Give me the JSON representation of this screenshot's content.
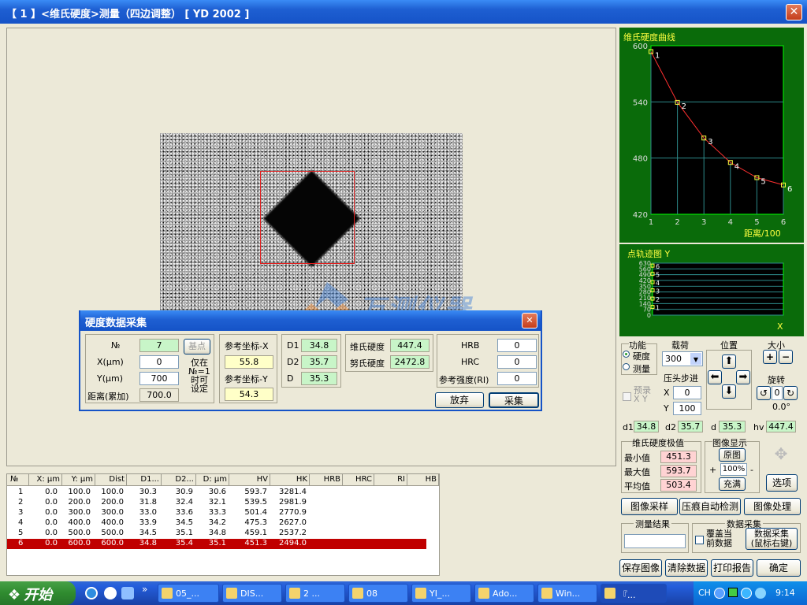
{
  "window": {
    "title": "【 1 】<维氏硬度>测量（四边调整）  [ YD 2002 ]",
    "close": "✕"
  },
  "watermark": "万测仪器",
  "dialog": {
    "title": "硬度数据采集",
    "close": "✕",
    "no_label": "№",
    "no_value": "7",
    "base_btn": "基点",
    "x_label": "X(μm)",
    "x_value": "0",
    "y_label": "Y(μm)",
    "y_value": "700",
    "dist_label": "距离(累加)",
    "dist_value": "700.0",
    "note": "仅在\n№=1\n时可\n设定",
    "refx_label": "参考坐标-X",
    "refx_value": "55.8",
    "refy_label": "参考坐标-Y",
    "refy_value": "54.3",
    "d1_label": "D1",
    "d1_value": "34.8",
    "d2_label": "D2",
    "d2_value": "35.7",
    "d_label": "D",
    "d_value": "35.3",
    "hv_label": "维氏硬度",
    "hv_value": "447.4",
    "hk_label": "努氏硬度",
    "hk_value": "2472.8",
    "hrb_label": "HRB",
    "hrb_value": "0",
    "hrc_label": "HRC",
    "hrc_value": "0",
    "ri_label": "参考强度(RI)",
    "ri_value": "0",
    "discard_btn": "放弃",
    "collect_btn": "采集"
  },
  "table": {
    "headers": [
      "№",
      "X: μm",
      "Y: μm",
      "Dist",
      "D1...",
      "D2...",
      "D: μm",
      "HV",
      "HK",
      "HRB",
      "HRC",
      "RI",
      "HB"
    ],
    "rows": [
      [
        "1",
        "0.0",
        "100.0",
        "100.0",
        "30.3",
        "30.9",
        "30.6",
        "593.7",
        "3281.4"
      ],
      [
        "2",
        "0.0",
        "200.0",
        "200.0",
        "31.8",
        "32.4",
        "32.1",
        "539.5",
        "2981.9"
      ],
      [
        "3",
        "0.0",
        "300.0",
        "300.0",
        "33.0",
        "33.6",
        "33.3",
        "501.4",
        "2770.9"
      ],
      [
        "4",
        "0.0",
        "400.0",
        "400.0",
        "33.9",
        "34.5",
        "34.2",
        "475.3",
        "2627.0"
      ],
      [
        "5",
        "0.0",
        "500.0",
        "500.0",
        "34.5",
        "35.1",
        "34.8",
        "459.1",
        "2537.2"
      ],
      [
        "6",
        "0.0",
        "600.0",
        "600.0",
        "34.8",
        "35.4",
        "35.1",
        "451.3",
        "2494.0"
      ]
    ],
    "selected_row": 5
  },
  "chart_data": [
    {
      "type": "line",
      "title": "维氏硬度曲线",
      "xlabel": "距离/100",
      "ylabel": "",
      "x": [
        1,
        2,
        3,
        4,
        5,
        6
      ],
      "series": [
        {
          "values": [
            593.7,
            539.5,
            501.4,
            475.3,
            459.1,
            451.3
          ]
        }
      ],
      "point_labels": [
        "1",
        "2",
        "3",
        "4",
        "5",
        "6"
      ],
      "ylim": [
        420,
        600
      ],
      "xlim": [
        1,
        6
      ],
      "y_ticks": [
        "600",
        "540",
        "480",
        "420"
      ],
      "x_ticks": [
        "1",
        "2",
        "3",
        "4",
        "5",
        "6"
      ],
      "grid": true,
      "colors": {
        "bg": "#0A6B0A",
        "plot": "#000000",
        "line": "#FF3030",
        "marker": "#FFFF40",
        "grid": "#2D8A8A",
        "text": "#FFFF40"
      }
    },
    {
      "type": "scatter",
      "title": "点轨迹图 Y",
      "xlabel": "X",
      "ylabel": "",
      "y_ticks": [
        "630",
        "560",
        "490",
        "420",
        "350",
        "280",
        "210",
        "140",
        "70",
        "0"
      ],
      "x": [
        0,
        0,
        0,
        0,
        0,
        0
      ],
      "y": [
        100,
        200,
        300,
        400,
        500,
        600
      ],
      "point_labels": [
        "1",
        "2",
        "3",
        "4",
        "5",
        "6"
      ],
      "ylim": [
        0,
        630
      ],
      "grid": true
    }
  ],
  "controls": {
    "func_title": "功能",
    "func_hardness": "硬度",
    "func_measure": "测量",
    "load_title": "载荷",
    "load_value": "300",
    "pos_title": "位置",
    "size_title": "大小",
    "size_plus": "+",
    "size_minus": "−",
    "step_title": "压头步进",
    "step_x_label": "X",
    "step_x": "0",
    "step_y_label": "Y",
    "step_y": "100",
    "preset_label": "预录\nX Y",
    "rotate_title": "旋转",
    "rotate_value": "0",
    "rotate_angle": "0.0°",
    "d1_label": "d1",
    "d1": "34.8",
    "d2_label": "d2",
    "d2": "35.7",
    "d_label": "d",
    "d": "35.3",
    "hv_label": "hv",
    "hv": "447.4",
    "ext_title": "维氏硬度极值",
    "min_label": "最小值",
    "min": "451.3",
    "max_label": "最大值",
    "max": "593.7",
    "avg_label": "平均值",
    "avg": "503.4",
    "img_title": "图像显示",
    "orig_btn": "原图",
    "zoom_plus": "+",
    "zoom": "100%",
    "zoom_minus": "-",
    "fill_btn": "充满",
    "options_btn": "选项",
    "capture_btn": "图像采样",
    "auto_btn": "压痕自动检测",
    "process_btn": "图像处理",
    "result_title": "测量结果",
    "collect_title": "数据采集",
    "cover_label": "覆盖当\n前数据",
    "collect_btn": "数据采集\n(鼠标右键)",
    "save_btn": "保存图像",
    "clear_btn": "清除数据",
    "print_btn": "打印报告",
    "ok_btn": "确定"
  },
  "taskbar": {
    "start": "开始",
    "chev": "»",
    "items": [
      "05_...",
      "DIS...",
      "2 ...",
      "08",
      "YI_...",
      "Ado...",
      "Win...",
      "『..."
    ],
    "lang": "CH",
    "clock": "9:14"
  }
}
